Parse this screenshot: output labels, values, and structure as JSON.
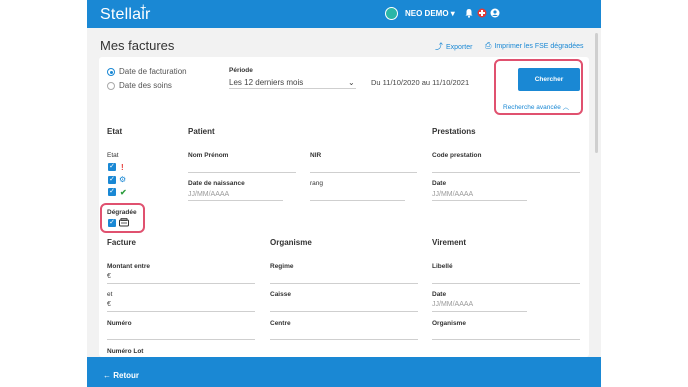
{
  "app": {
    "logo": "Stellair",
    "logo_mark": "+",
    "user_name": "NEO DEMO",
    "user_caret": "▾"
  },
  "page": {
    "title": "Mes factures",
    "export_label": "Exporter",
    "print_label": "Imprimer les FSE dégradées"
  },
  "filters": {
    "date_type_options": [
      "Date de facturation",
      "Date des soins"
    ],
    "selected_date_type": "Date de facturation",
    "periode_label": "Période",
    "periode_value": "Les 12 derniers mois",
    "date_range": "Du 11/10/2020 au 11/10/2021",
    "search_button": "Chercher",
    "advanced_search": "Recherche avancée"
  },
  "etat": {
    "section": "Etat",
    "field_label": "Etat",
    "degradee_label": "Dégradée"
  },
  "patient": {
    "section": "Patient",
    "nom_prenom": "Nom Prénom",
    "nir": "NIR",
    "date_naissance": "Date de naissance",
    "date_placeholder": "JJ/MM/AAAA",
    "rang": "rang"
  },
  "prestations": {
    "section": "Prestations",
    "code_prestation": "Code prestation",
    "date": "Date",
    "date_placeholder": "JJ/MM/AAAA"
  },
  "facture": {
    "section": "Facture",
    "montant_entre": "Montant entre",
    "currency": "€",
    "et": "et",
    "numero": "Numéro",
    "numero_lot": "Numéro Lot"
  },
  "organisme": {
    "section": "Organisme",
    "regime": "Regime",
    "caisse": "Caisse",
    "centre": "Centre"
  },
  "virement": {
    "section": "Virement",
    "libelle": "Libellé",
    "date": "Date",
    "date_placeholder": "JJ/MM/AAAA",
    "organisme": "Organisme"
  },
  "footer": {
    "back_label": "← Retour"
  },
  "colors": {
    "primary": "#1a88d4",
    "highlight": "#e0516f",
    "error": "#e53935",
    "success": "#2e9e3f"
  }
}
